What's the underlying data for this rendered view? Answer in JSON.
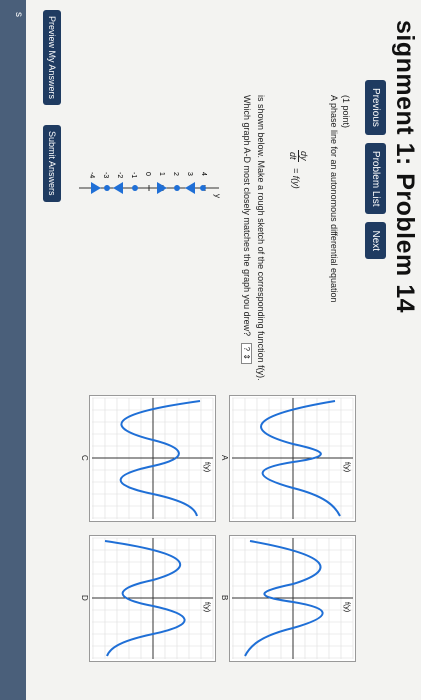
{
  "header": {
    "title": "signment 1: Problem 14"
  },
  "nav": {
    "previous": "Previous",
    "problem_list": "Problem List",
    "next": "Next"
  },
  "problem": {
    "points": "(1 point)",
    "intro": "A phase line for an autonomous differential equation",
    "equation_top": "dy",
    "equation_bottom": "dt",
    "equation_right": "= f(y)",
    "instructions": "is shown below. Make a rough sketch of the corresponding function f(y).",
    "question": "Which graph A-D most closely matches the graph you drew?",
    "answer_selected": "?"
  },
  "phase_line": {
    "axis_label": "y",
    "ticks": [
      "4",
      "3",
      "2",
      "1",
      "0",
      "-1",
      "-2",
      "-3",
      "-4"
    ],
    "arrow_color": "#1f6fd6"
  },
  "graphs": [
    {
      "label": "A",
      "axis_label": "f(y)"
    },
    {
      "label": "B",
      "axis_label": "f(y)"
    },
    {
      "label": "C",
      "axis_label": "f(y)"
    },
    {
      "label": "D",
      "axis_label": "f(y)"
    }
  ],
  "footer": {
    "preview": "Preview My Answers",
    "submit": "Submit Answers"
  },
  "colors": {
    "curve": "#1f6fd6",
    "button": "#1f3b61",
    "sidebar": "#4a5f7a"
  }
}
